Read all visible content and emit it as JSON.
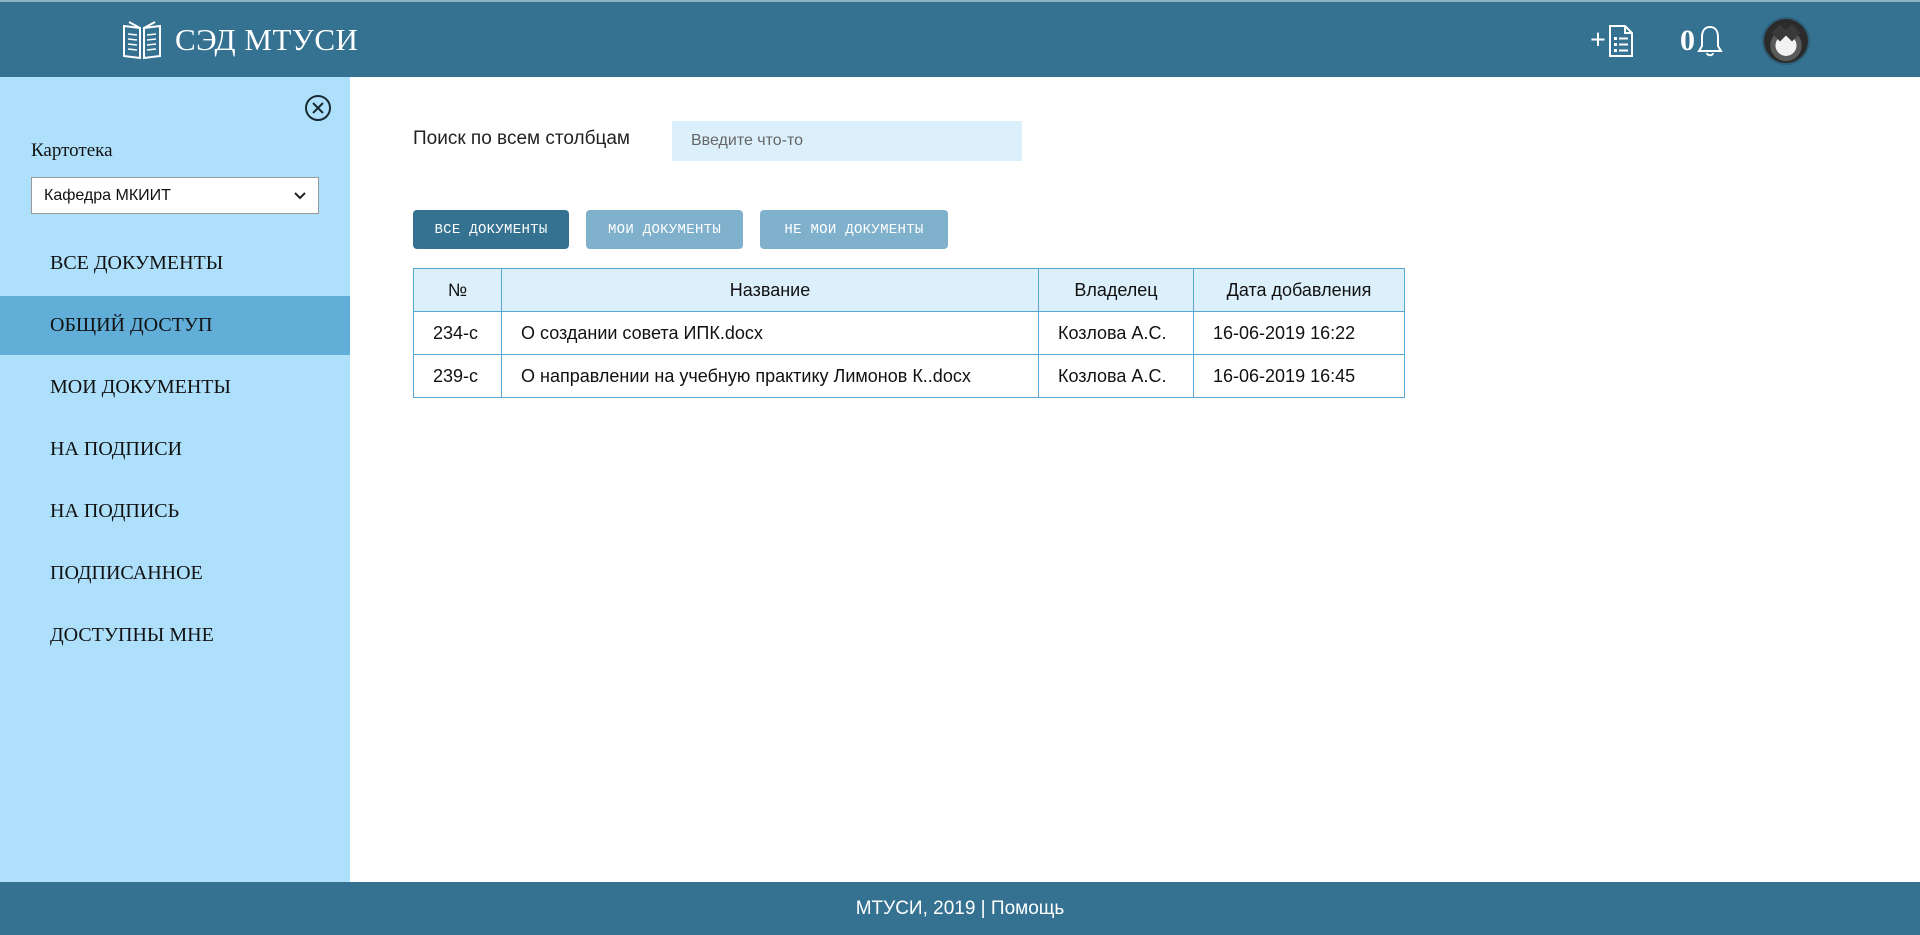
{
  "header": {
    "brand_title": "СЭД МТУСИ",
    "add_plus": "+",
    "notification_count": "0"
  },
  "sidebar": {
    "kartoteka_label": "Картотека",
    "kartoteka_selected": "Кафедра МКИИТ",
    "items": [
      {
        "label": "ВСЕ ДОКУМЕНТЫ",
        "active": false
      },
      {
        "label": "ОБЩИЙ ДОСТУП",
        "active": true
      },
      {
        "label": "МОИ ДОКУМЕНТЫ",
        "active": false
      },
      {
        "label": "НА ПОДПИСИ",
        "active": false
      },
      {
        "label": "НА ПОДПИСЬ",
        "active": false
      },
      {
        "label": "ПОДПИСАННОЕ",
        "active": false
      },
      {
        "label": "ДОСТУПНЫ МНЕ",
        "active": false
      }
    ]
  },
  "search": {
    "label": "Поиск по всем столбцам",
    "placeholder": "Введите что-то",
    "value": ""
  },
  "filters": {
    "all": "ВСЕ ДОКУМЕНТЫ",
    "mine": "МОИ ДОКУМЕНТЫ",
    "not_mine": "НЕ МОИ ДОКУМЕНТЫ"
  },
  "table": {
    "headers": [
      "№",
      "Название",
      "Владелец",
      "Дата добавления"
    ],
    "rows": [
      [
        "234-с",
        "О создании совета ИПК.docx",
        "Козлова А.С.",
        "16-06-2019 16:22"
      ],
      [
        "239-с",
        "О направлении на учебную практику Лимонов К..docx",
        "Козлова А.С.",
        "16-06-2019 16:45"
      ]
    ]
  },
  "footer": {
    "copyright": "МТУСИ, 2019",
    "separator": " | ",
    "help": "Помощь"
  },
  "colors": {
    "header_bg": "#357292",
    "sidebar_bg": "#aee0fb",
    "sidebar_active": "#61afd9",
    "button_primary": "#357292",
    "button_secondary": "#7fb1cc"
  },
  "icons": {
    "brand": "book-icon",
    "add_document": "document-list-icon",
    "notifications": "bell-icon",
    "close_sidebar": "close-circle-icon",
    "select": "chevron-down-icon"
  }
}
